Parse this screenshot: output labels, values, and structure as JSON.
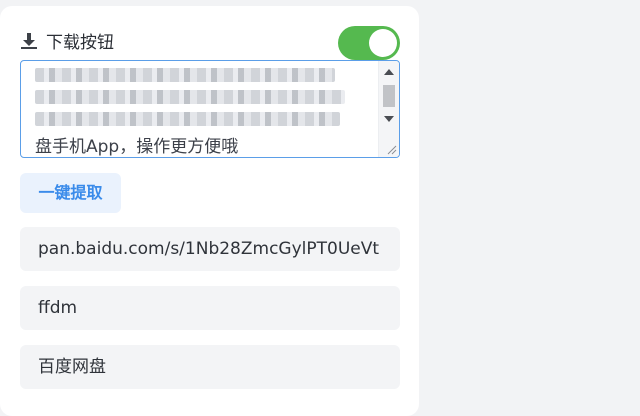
{
  "header": {
    "title": "下载按钮",
    "icon": "download-icon"
  },
  "toggle": {
    "state": "on",
    "color": "#55b94f"
  },
  "textarea": {
    "visible_text": "盘手机App，操作更方便哦"
  },
  "extract_button": {
    "label": "一键提取"
  },
  "fields": {
    "link": "pan.baidu.com/s/1Nb28ZmcGylPT0UeVt",
    "code": "ffdm",
    "platform": "百度网盘"
  }
}
